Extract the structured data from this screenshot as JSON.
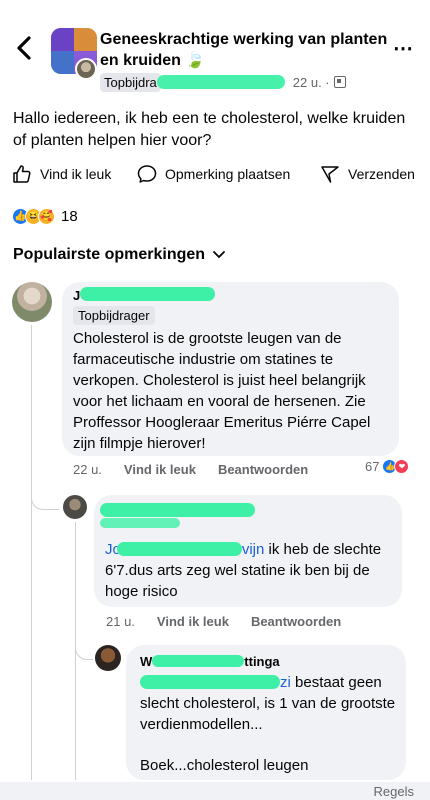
{
  "header": {
    "back_icon": "chevron-left-icon",
    "group_name": "Geneeskrachtige werking van planten en kruiden",
    "leaf_emoji": "🍃",
    "author_badge": "Topbijdra",
    "time": "22 u. ·",
    "more_icon": "more-dots-icon",
    "more_glyph": "⋯"
  },
  "post": {
    "text": "Hallo iedereen, ik heb een te cholesterol, welke kruiden of planten helpen hier voor?"
  },
  "actions": {
    "like": "Vind ik leuk",
    "comment": "Opmerking plaatsen",
    "share": "Verzenden"
  },
  "reactions": {
    "count": "18"
  },
  "comments_header": {
    "label": "Populairste opmerkingen",
    "chevron": "⌄"
  },
  "comments": [
    {
      "name": "J",
      "badge": "Topbijdrager",
      "text": "Cholesterol is de grootste leugen van de farmaceutische industrie om statines te verkopen. Cholesterol is juist heel belangrijk voor het lichaam en vooral de hersenen. Zie Proffessor Hoogleraar Emeritus Piérre Capel zijn filmpje hierover!",
      "time": "22 u.",
      "like": "Vind ik leuk",
      "reply": "Beantwoorden",
      "reaction_count": "67"
    },
    {
      "name": "",
      "mention": "Jo",
      "mention_tail": "vijn",
      "text": " ik heb de slechte 6'7.dus arts zeg wel statine ik ben bij de hoge risico",
      "time": "21 u.",
      "like": "Vind ik leuk",
      "reply": "Beantwoorden"
    },
    {
      "name": "W",
      "name_tail": "ttinga",
      "mention_tail": "zi",
      "text": " bestaat geen slecht cholesterol,  is 1 van de grootste verdienmodellen...",
      "text2": "Boek...cholesterol leugen"
    }
  ],
  "footer": {
    "rules": "Regels"
  }
}
